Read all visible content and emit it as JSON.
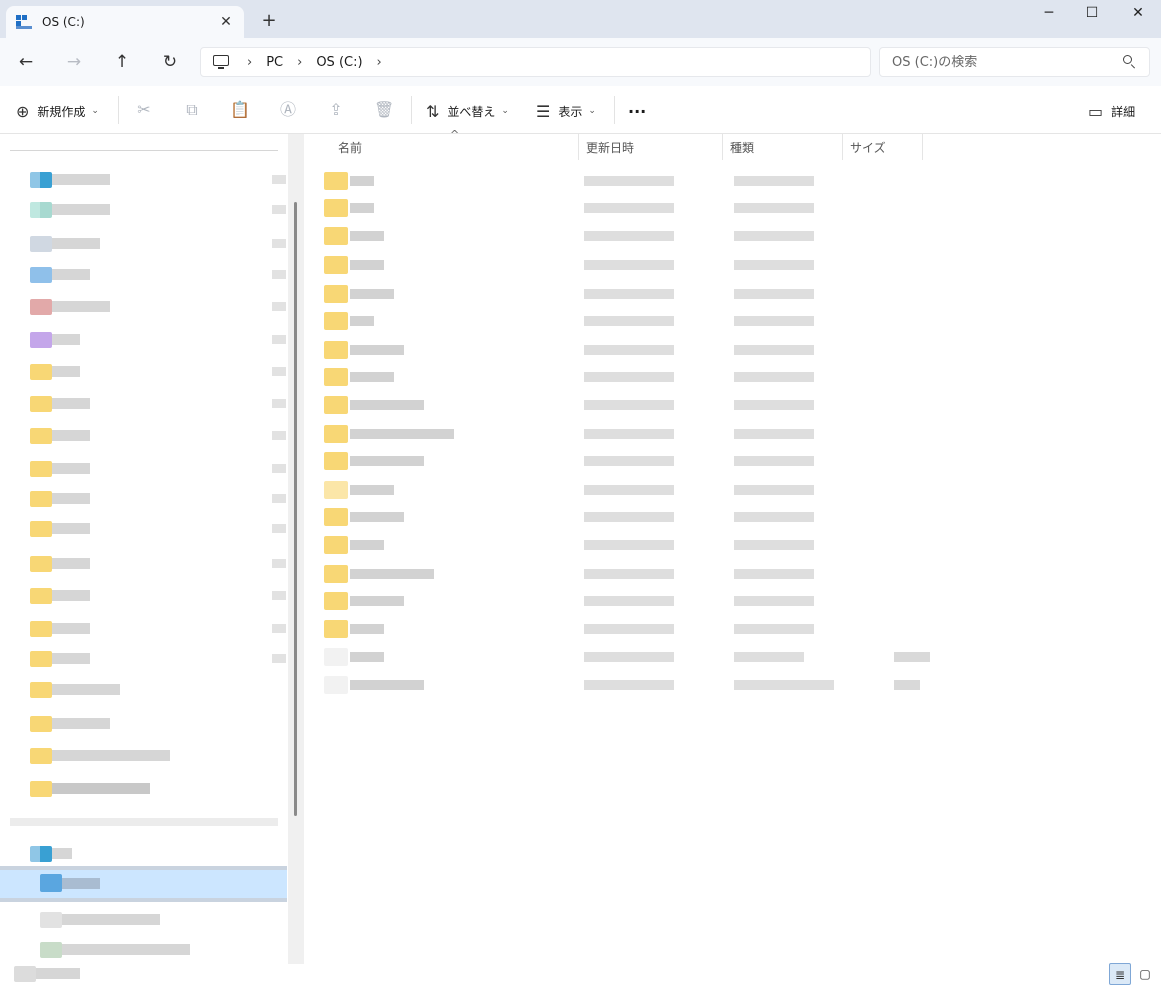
{
  "window": {
    "tab_title": "OS (C:)",
    "tab_close": "✕",
    "new_tab": "+",
    "minimize": "─",
    "maximize": "☐",
    "close": "✕"
  },
  "nav": {
    "back": "←",
    "forward": "→",
    "up": "↑",
    "refresh": "↻",
    "breadcrumb": [
      "PC",
      "OS (C:)"
    ],
    "sep": "›"
  },
  "search": {
    "placeholder": "OS (C:)の検索"
  },
  "commands": {
    "new": "新規作成",
    "sort": "並べ替え",
    "view": "表示",
    "more": "···",
    "details": "詳細",
    "icons": {
      "new": "⊕",
      "sort": "⇅",
      "view": "☰",
      "cut": "✂",
      "copy": "⧉",
      "paste": "📋",
      "rename": "Ⓐ",
      "share": "⇪",
      "delete": "🗑",
      "details": "▭",
      "chevron": "⌄"
    }
  },
  "columns": {
    "name": "名前",
    "date": "更新日時",
    "type": "種類",
    "size": "サイズ",
    "sort_indicator": "^"
  },
  "view_toggles": {
    "details": "≣",
    "tiles": "▢"
  },
  "colors": {
    "folder": "#f8d775",
    "selection": "#cce6ff",
    "titlebar": "#dfe5ef"
  }
}
